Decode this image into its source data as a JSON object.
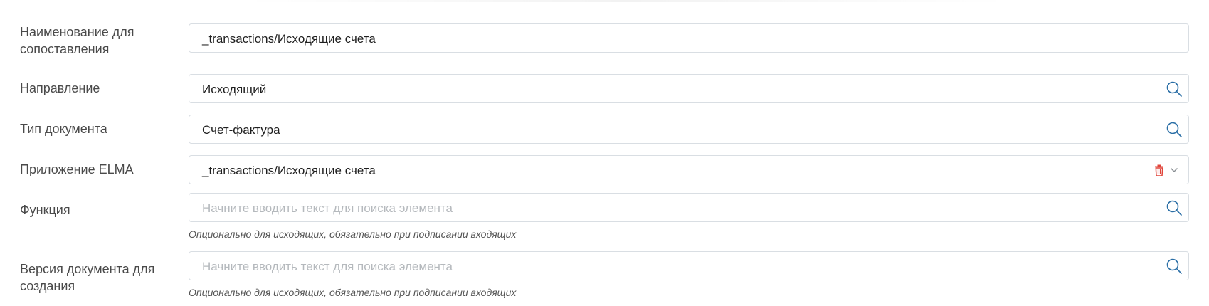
{
  "form": {
    "rows": [
      {
        "label": "Наименование для сопоставления",
        "value": "_transactions/Исходящие счета"
      },
      {
        "label": "Направление",
        "value": "Исходящий"
      },
      {
        "label": "Тип документа",
        "value": "Счет-фактура"
      },
      {
        "label": "Приложение ELMA",
        "value": "_transactions/Исходящие счета"
      },
      {
        "label": "Функция",
        "placeholder": "Начните вводить текст для поиска элемента",
        "hint": "Опционально для исходящих, обязательно при подписании входящих"
      },
      {
        "label": "Версия документа для создания",
        "placeholder": "Начните вводить текст для поиска элемента",
        "hint": "Опционально для исходящих, обязательно при подписании входящих"
      }
    ]
  },
  "icons": {
    "search": "search-icon",
    "delete": "trash-icon",
    "dropdown": "chevron-down-icon"
  },
  "colors": {
    "accent": "#2b6fa6",
    "danger": "#e0443a",
    "border": "#d9dee3"
  }
}
